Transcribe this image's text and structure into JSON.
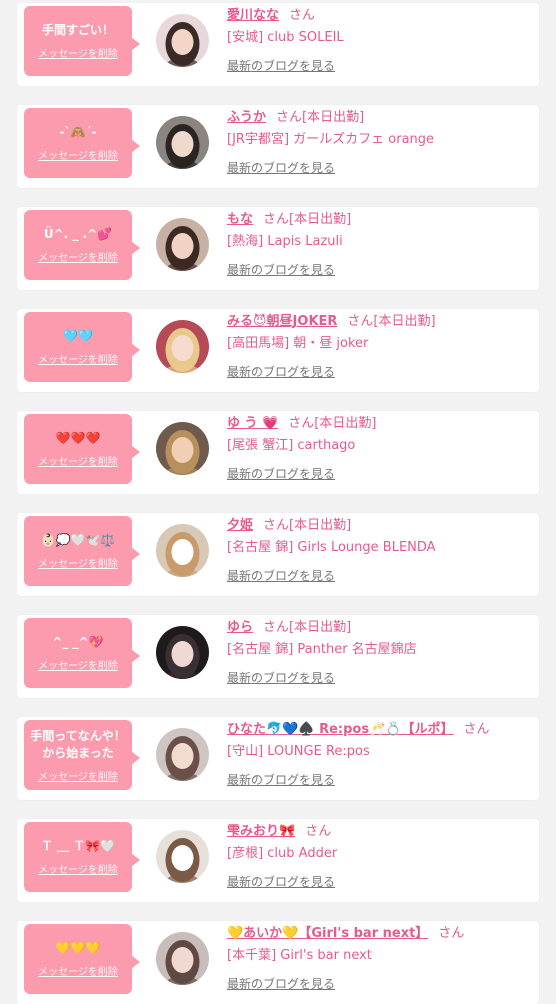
{
  "delete_label": "メッセージを削除",
  "blog_label": "最新のブログを見る",
  "cards": [
    {
      "message": "手間すごい！",
      "name": "愛川なな",
      "san": "さん",
      "shop": "[安城] club SOLEIL",
      "avatar": [
        "#e8d8dc",
        "#3a2a26",
        "#f3d6c8"
      ]
    },
    {
      "message": "-`🙈´-",
      "name": "ふうか",
      "san": "さん[本日出勤]",
      "shop": "[JR宇都宮] ガールズカフェ orange",
      "avatar": [
        "#8b8581",
        "#2a2422",
        "#eed9cd"
      ]
    },
    {
      "message": "Ü^. _ .^💕",
      "name": "もな",
      "san": "さん[本日出勤]",
      "shop": "[熱海] Lapis Lazuli",
      "avatar": [
        "#c7b0a4",
        "#3c2a22",
        "#f2d3c3"
      ]
    },
    {
      "message": "🩵🩵",
      "name": "みる😈朝昼JOKER",
      "san": "さん[本日出勤]",
      "shop": "[高田馬場] 朝・昼 joker",
      "avatar": [
        "#b74a57",
        "#e9c98b",
        "#f5dccf"
      ]
    },
    {
      "message": "❤️❤️❤️",
      "name": "ゆ う 💗",
      "san": "さん[本日出勤]",
      "shop": "[尾張 蟹江] carthago",
      "avatar": [
        "#6f5a4e",
        "#b9905d",
        "#f0cfb5"
      ]
    },
    {
      "message": "👶🏻💭🤍🕊️⚖️",
      "name": "夕姫",
      "san": "さん[本日出勤]",
      "shop": "[名古屋 錦] Girls Lounge BLENDA",
      "avatar": [
        "#d8c8b6",
        "#c79b6c",
        "#ffffff"
      ]
    },
    {
      "message": "^_ _^💖",
      "name": "ゆら",
      "san": "さん[本日出勤]",
      "shop": "[名古屋 錦] Panther 名古屋錦店",
      "avatar": [
        "#1f1a1c",
        "#3a2f33",
        "#f1d8d2"
      ]
    },
    {
      "message": "手間ってなんや！\nから始まった",
      "name": "ひなた🐬💙♠️ Re:pos🥂💍【ルポ】",
      "san": "さん",
      "shop": "[守山] LOUNGE Re:pos",
      "avatar": [
        "#cfc6c3",
        "#6a5048",
        "#f2dbd0"
      ]
    },
    {
      "message": "Ｔ ＿ Ｔ🎀🤍",
      "name": "雫みおり🎀",
      "san": "さん",
      "shop": "[彦根] club Adder",
      "avatar": [
        "#e7e0d8",
        "#7a5a45",
        "#ffffff"
      ]
    },
    {
      "message": "💛💛💛",
      "name": "💛あいか💛【Girl's bar next】",
      "san": "さん",
      "shop": "[本千葉] Girl's bar next",
      "avatar": [
        "#c9bdbb",
        "#5e4a43",
        "#f1d9cf"
      ]
    }
  ]
}
